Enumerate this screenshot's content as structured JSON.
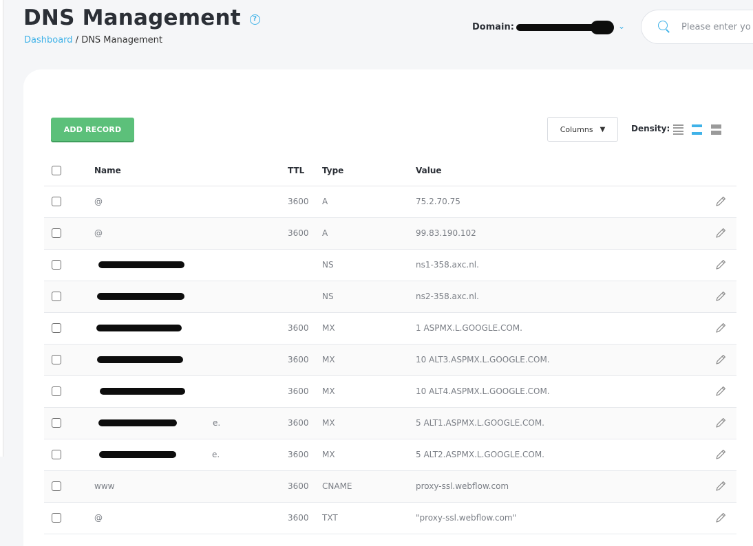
{
  "header": {
    "title": "DNS Management",
    "breadcrumb": {
      "home": "Dashboard",
      "separator": " / ",
      "current": "DNS Management"
    },
    "domain_label": "Domain:",
    "search_placeholder": "Please enter yo"
  },
  "toolbar": {
    "add_record_label": "ADD RECORD",
    "columns_label": "Columns",
    "density_label": "Density:"
  },
  "table": {
    "headers": {
      "name": "Name",
      "ttl": "TTL",
      "type": "Type",
      "value": "Value"
    },
    "rows": [
      {
        "name": "@",
        "ttl": "3600",
        "type": "A",
        "value": "75.2.70.75",
        "redacted": false
      },
      {
        "name": "@",
        "ttl": "3600",
        "type": "A",
        "value": "99.83.190.102",
        "redacted": false
      },
      {
        "name": "",
        "ttl": "",
        "type": "NS",
        "value": "ns1-358.axc.nl.",
        "redacted": true
      },
      {
        "name": "",
        "ttl": "",
        "type": "NS",
        "value": "ns2-358.axc.nl.",
        "redacted": true
      },
      {
        "name": "",
        "ttl": "3600",
        "type": "MX",
        "value": "1 ASPMX.L.GOOGLE.COM.",
        "redacted": true
      },
      {
        "name": "",
        "ttl": "3600",
        "type": "MX",
        "value": "10 ALT3.ASPMX.L.GOOGLE.COM.",
        "redacted": true
      },
      {
        "name": "",
        "ttl": "3600",
        "type": "MX",
        "value": "10 ALT4.ASPMX.L.GOOGLE.COM.",
        "redacted": true
      },
      {
        "name": "e.",
        "ttl": "3600",
        "type": "MX",
        "value": "5 ALT1.ASPMX.L.GOOGLE.COM.",
        "redacted": true
      },
      {
        "name": "e.",
        "ttl": "3600",
        "type": "MX",
        "value": "5 ALT2.ASPMX.L.GOOGLE.COM.",
        "redacted": true
      },
      {
        "name": "www",
        "ttl": "3600",
        "type": "CNAME",
        "value": "proxy-ssl.webflow.com",
        "redacted": false
      },
      {
        "name": "@",
        "ttl": "3600",
        "type": "TXT",
        "value": "\"proxy-ssl.webflow.com\"",
        "redacted": false
      }
    ]
  },
  "colors": {
    "accent": "#3fb2e8",
    "add_button": "#5cc07a",
    "background": "#f5f6f8"
  },
  "icons": [
    "help-icon",
    "chevron-down-icon",
    "search-icon",
    "caret-down-icon",
    "density-compact-icon",
    "density-standard-icon",
    "density-comfortable-icon",
    "pencil-icon"
  ]
}
